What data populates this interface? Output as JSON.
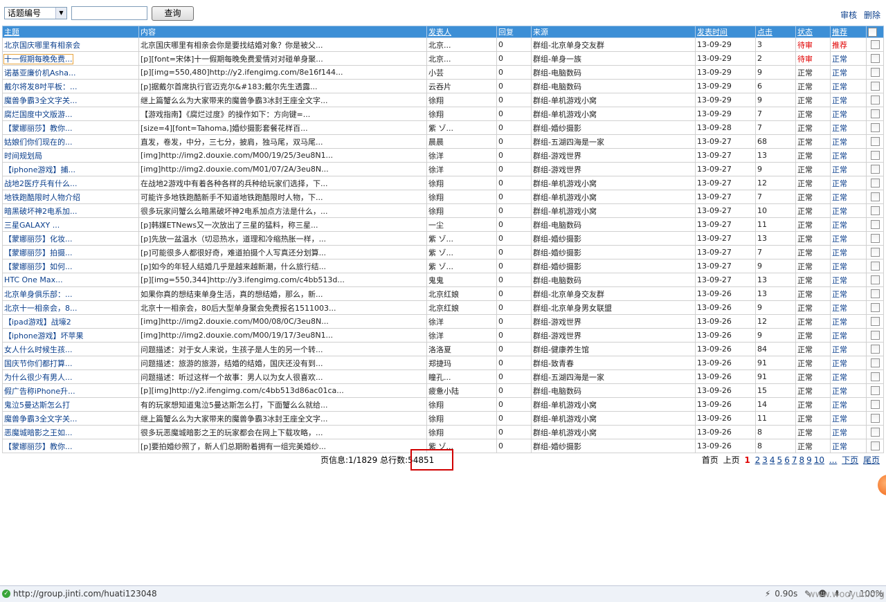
{
  "toolbar": {
    "select_value": "话题编号",
    "query_label": "查询",
    "review_label": "审核",
    "delete_label": "删除"
  },
  "columns": [
    "主题",
    "内容",
    "发表人",
    "回复",
    "来源",
    "发表时间",
    "点击",
    "状态",
    "推荐"
  ],
  "rows": [
    [
      "北京国庆哪里有相亲会",
      "北京国庆哪里有相亲会你是要找结婚对象？你是被父...",
      "北京...",
      "0",
      "群组-北京单身交友群",
      "13-09-29",
      "3",
      "待审",
      "推荐"
    ],
    [
      "十一假期每晚免费...",
      "[p][font=宋体]十一假期每晚免费爱情对对碰单身聚...",
      "北京...",
      "0",
      "群组-单身一族",
      "13-09-29",
      "2",
      "待审",
      "正常"
    ],
    [
      "诺基亚廉价机Asha...",
      "[p][img=550,480]http://y2.ifengimg.com/8e16f144...",
      "小芸",
      "0",
      "群组-电脑数码",
      "13-09-29",
      "9",
      "正常",
      "正常"
    ],
    [
      "戴尔将发8吋平板：...",
      "[p]据戴尔首席执行官迈克尔&#183;戴尔先生透露...",
      "云吞片",
      "0",
      "群组-电脑数码",
      "13-09-29",
      "6",
      "正常",
      "正常"
    ],
    [
      "魔兽争霸3全文字关...",
      "继上篇蟹么么为大家带来的魔兽争霸3冰封王座全文字...",
      "徐翔",
      "0",
      "群组-单机游戏小窝",
      "13-09-29",
      "9",
      "正常",
      "正常"
    ],
    [
      "腐烂国度中文版游...",
      "【游戏指南】《腐烂过度》的操作如下：方向键=...",
      "徐翔",
      "0",
      "群组-单机游戏小窝",
      "13-09-29",
      "7",
      "正常",
      "正常"
    ],
    [
      "【蒙娜丽莎】教你...",
      "[size=4][font=Tahoma,]婚纱摄影套餐花样百...",
      "紫 ゾ...",
      "0",
      "群组-婚纱摄影",
      "13-09-28",
      "7",
      "正常",
      "正常"
    ],
    [
      "姑娘们你们现在的...",
      "直发，卷发，中分，三七分，披肩，独马尾，双马尾...",
      "晨晨",
      "0",
      "群组-五湖四海是一家",
      "13-09-27",
      "68",
      "正常",
      "正常"
    ],
    [
      "时间规划局",
      "[img]http://img2.douxie.com/M00/19/25/3eu8N1...",
      "徐洋",
      "0",
      "群组-游戏世界",
      "13-09-27",
      "13",
      "正常",
      "正常"
    ],
    [
      "【iphone游戏】捕...",
      "[img]http://img2.douxie.com/M01/07/2A/3eu8N...",
      "徐洋",
      "0",
      "群组-游戏世界",
      "13-09-27",
      "9",
      "正常",
      "正常"
    ],
    [
      "战地2医疗兵有什么...",
      "在战地2游戏中有着各种各样的兵种给玩家们选择，下...",
      "徐翔",
      "0",
      "群组-单机游戏小窝",
      "13-09-27",
      "12",
      "正常",
      "正常"
    ],
    [
      "地铁跑酷限时人物介绍",
      "可能许多地铁跑酷新手不知道地铁跑酷限时人物，下...",
      "徐翔",
      "0",
      "群组-单机游戏小窝",
      "13-09-27",
      "7",
      "正常",
      "正常"
    ],
    [
      "暗黑破坏神2电系加...",
      "很多玩家问蟹么么暗黑破坏神2电系加点方法是什么，...",
      "徐翔",
      "0",
      "群组-单机游戏小窝",
      "13-09-27",
      "10",
      "正常",
      "正常"
    ],
    [
      "三星GALAXY ...",
      "[p]韩媒ETNews又一次放出了三星的猛料，称三星...",
      "一尘",
      "0",
      "群组-电脑数码",
      "13-09-27",
      "11",
      "正常",
      "正常"
    ],
    [
      "【蒙娜丽莎】化妆...",
      "[p]先放一盆温水（切忌热水，道理和冷缩热胀一样，...",
      "紫 ゾ...",
      "0",
      "群组-婚纱摄影",
      "13-09-27",
      "13",
      "正常",
      "正常"
    ],
    [
      "【蒙娜丽莎】拍摄...",
      "[p]可能很多人都很好奇，难道拍摄个人写真还分划算...",
      "紫 ゾ...",
      "0",
      "群组-婚纱摄影",
      "13-09-27",
      "7",
      "正常",
      "正常"
    ],
    [
      "【蒙娜丽莎】如何...",
      "[p]如今的年轻人结婚几乎是越来越新潮，什么旅行结...",
      "紫 ゾ...",
      "0",
      "群组-婚纱摄影",
      "13-09-27",
      "9",
      "正常",
      "正常"
    ],
    [
      "HTC One Max...",
      "[p][img=550,344]http://y3.ifengimg.com/c4bb513d...",
      "鬼鬼",
      "0",
      "群组-电脑数码",
      "13-09-27",
      "13",
      "正常",
      "正常"
    ],
    [
      "北京单身俱乐部：...",
      "如果你真的想结束单身生活，真的想结婚，那么，新...",
      "北京红娘",
      "0",
      "群组-北京单身交友群",
      "13-09-26",
      "13",
      "正常",
      "正常"
    ],
    [
      "北京十一相亲会，8...",
      "北京十一相亲会，80后大型单身聚会免费报名1511003...",
      "北京红娘",
      "0",
      "群组-北京单身男女联盟",
      "13-09-26",
      "9",
      "正常",
      "正常"
    ],
    [
      "【ipad游戏】战壕2",
      "[img]http://img2.douxie.com/M00/08/0C/3eu8N...",
      "徐洋",
      "0",
      "群组-游戏世界",
      "13-09-26",
      "12",
      "正常",
      "正常"
    ],
    [
      "【iphone游戏】坏苹果",
      "[img]http://img2.douxie.com/M00/19/17/3eu8N1...",
      "徐洋",
      "0",
      "群组-游戏世界",
      "13-09-26",
      "9",
      "正常",
      "正常"
    ],
    [
      "女人什么时候生孩...",
      "问题描述：对于女人来说，生孩子是人生的另一个转...",
      "洛洛夏",
      "0",
      "群组-健康养生馆",
      "13-09-26",
      "84",
      "正常",
      "正常"
    ],
    [
      "国庆节你们都打算...",
      "问题描述：旅游的旅游，结婚的结婚，国庆还没有到...",
      "郑捷玛",
      "0",
      "群组-致青春",
      "13-09-26",
      "91",
      "正常",
      "正常"
    ],
    [
      "为什么很少有男人...",
      "问题描述：听过这样一个故事：男人以为女人很喜欢...",
      "瞳孔...",
      "0",
      "群组-五湖四海是一家",
      "13-09-26",
      "91",
      "正常",
      "正常"
    ],
    [
      "假广告称iPhone升...",
      "[p][img]http://y2.ifengimg.com/c4bb513d86ac01ca...",
      "疲惫小陆",
      "0",
      "群组-电脑数码",
      "13-09-26",
      "15",
      "正常",
      "正常"
    ],
    [
      "鬼泣5曼达斯怎么打",
      "有的玩家想知道鬼泣5曼达斯怎么打，下面蟹么么就给...",
      "徐翔",
      "0",
      "群组-单机游戏小窝",
      "13-09-26",
      "14",
      "正常",
      "正常"
    ],
    [
      "魔兽争霸3全文字关...",
      "继上篇蟹么么为大家带来的魔兽争霸3冰封王座全文字...",
      "徐翔",
      "0",
      "群组-单机游戏小窝",
      "13-09-26",
      "11",
      "正常",
      "正常"
    ],
    [
      "恶魔城暗影之王如...",
      "很多玩恶魔城暗影之王的玩家都会在网上下载攻略，...",
      "徐翔",
      "0",
      "群组-单机游戏小窝",
      "13-09-26",
      "8",
      "正常",
      "正常"
    ],
    [
      "【蒙娜丽莎】教你...",
      "[p]要拍婚纱照了，新人们总期盼着拥有一组完美婚纱...",
      "紫 ゾ...",
      "0",
      "群组-婚纱摄影",
      "13-09-26",
      "8",
      "正常",
      "正常"
    ]
  ],
  "footer": {
    "page_info": "页信息:1/1829",
    "total_label": "总行数:",
    "total_value": "54851"
  },
  "pager": {
    "first": "首页",
    "prev": "上页",
    "current": "1",
    "pages": [
      "2",
      "3",
      "4",
      "5",
      "6",
      "7",
      "8",
      "9",
      "10"
    ],
    "more": "...",
    "next": "下页",
    "last": "尾页"
  },
  "statusbar": {
    "url": "http://group.jinti.com/huati123048",
    "load_time": "0.90s",
    "zoom": "100%"
  },
  "watermark": "www.wooyun.org",
  "colors": {
    "header_bg": "#3d8fd6",
    "link": "#0b3f8c",
    "pending": "#e00000",
    "highlight_box": "#d00000"
  }
}
